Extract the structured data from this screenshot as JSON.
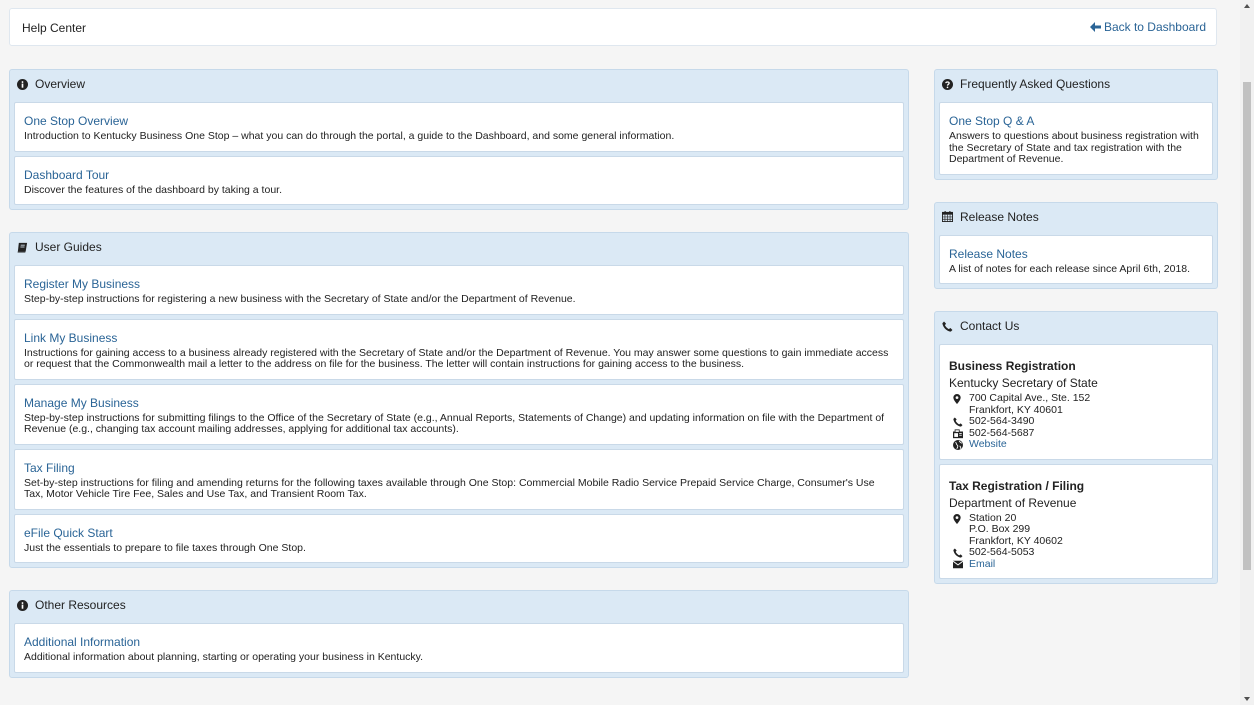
{
  "header": {
    "title": "Help Center",
    "back_label": "Back to Dashboard"
  },
  "overview": {
    "heading": "Overview",
    "items": [
      {
        "title": "One Stop Overview",
        "desc": "Introduction to Kentucky Business One Stop – what you can do through the portal, a guide to the Dashboard, and some general information."
      },
      {
        "title": "Dashboard Tour",
        "desc": "Discover the features of the dashboard by taking a tour."
      }
    ]
  },
  "user_guides": {
    "heading": "User Guides",
    "items": [
      {
        "title": "Register My Business",
        "desc": "Step-by-step instructions for registering a new business with the Secretary of State and/or the Department of Revenue."
      },
      {
        "title": "Link My Business",
        "desc": "Instructions for gaining access to a business already registered with the Secretary of State and/or the Department of Revenue. You may answer some questions to gain immediate access or request that the Commonwealth mail a letter to the address on file for the business. The letter will contain instructions for gaining access to the business."
      },
      {
        "title": "Manage My Business",
        "desc": "Step-by-step instructions for submitting filings to the Office of the Secretary of State (e.g., Annual Reports, Statements of Change) and updating information on file with the Department of Revenue (e.g., changing tax account mailing addresses, applying for additional tax accounts)."
      },
      {
        "title": "Tax Filing",
        "desc": "Set-by-step instructions for filing and amending returns for the following taxes available through One Stop: Commercial Mobile Radio Service Prepaid Service Charge, Consumer's Use Tax, Motor Vehicle Tire Fee, Sales and Use Tax, and Transient Room Tax."
      },
      {
        "title": "eFile Quick Start",
        "desc": "Just the essentials to prepare to file taxes through One Stop."
      }
    ]
  },
  "other_resources": {
    "heading": "Other Resources",
    "items": [
      {
        "title": "Additional Information",
        "desc": "Additional information about planning, starting or operating your business in Kentucky."
      }
    ]
  },
  "faq": {
    "heading": "Frequently Asked Questions",
    "items": [
      {
        "title": "One Stop Q & A",
        "desc": "Answers to questions about business registration with the Secretary of State and tax registration with the Department of Revenue."
      }
    ]
  },
  "release_notes": {
    "heading": "Release Notes",
    "items": [
      {
        "title": "Release Notes",
        "desc": "A list of notes for each release since April 6th, 2018."
      }
    ]
  },
  "contact": {
    "heading": "Contact Us",
    "business_registration": {
      "title": "Business Registration",
      "org": "Kentucky Secretary of State",
      "address_line1": "700 Capital Ave., Ste. 152",
      "address_line2": "Frankfort, KY 40601",
      "phone": "502-564-3490",
      "fax": "502-564-5687",
      "website_label": "Website"
    },
    "tax_registration": {
      "title": "Tax Registration / Filing",
      "org": "Department of Revenue",
      "address_line1": "Station 20",
      "address_line2": "P.O. Box 299",
      "address_line3": "Frankfort, KY 40602",
      "phone": "502-564-5053",
      "email_label": "Email"
    }
  },
  "colors": {
    "panel_bg": "#dbe9f5",
    "link": "#2a6496",
    "page_bg": "#f5f5f5"
  }
}
